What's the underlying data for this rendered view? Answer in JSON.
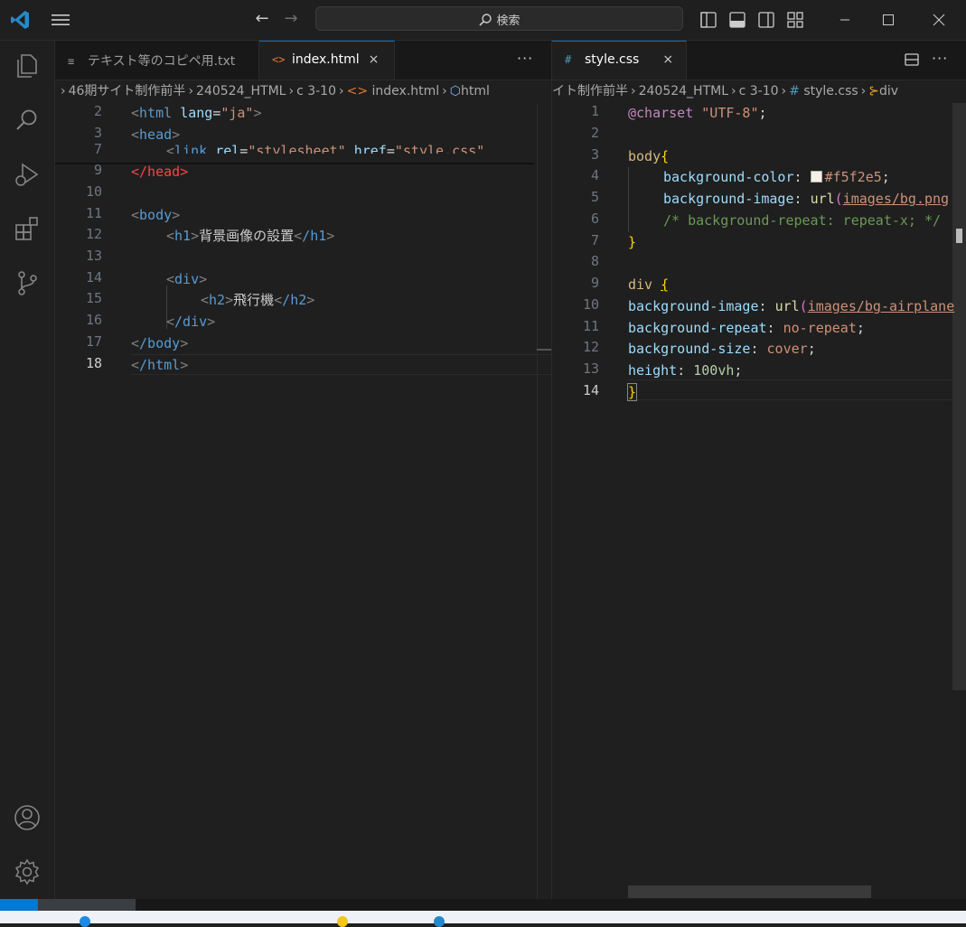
{
  "titlebar": {
    "search_label": "検索"
  },
  "left_group": {
    "tabs": [
      {
        "label": "テキスト等のコピペ用.txt",
        "icon": "≡",
        "active": false
      },
      {
        "label": "index.html",
        "icon": "<>",
        "active": true,
        "close": "×"
      }
    ],
    "tab_actions": "···",
    "breadcrumb": [
      {
        "label": "46期サイト制作前半"
      },
      {
        "label": "240524_HTML"
      },
      {
        "label": "c 3-10"
      },
      {
        "label": "index.html"
      },
      {
        "label": "html"
      }
    ],
    "lines": [
      {
        "n": "2"
      },
      {
        "n": "3"
      },
      {
        "n": "7"
      },
      {
        "n": "9"
      },
      {
        "n": "10"
      },
      {
        "n": "11"
      },
      {
        "n": "12"
      },
      {
        "n": "13"
      },
      {
        "n": "14"
      },
      {
        "n": "15"
      },
      {
        "n": "16"
      },
      {
        "n": "17"
      },
      {
        "n": "18"
      }
    ],
    "code": {
      "l2_tag": "html",
      "l2_attr": "lang",
      "l2_val": "\"ja\"",
      "l3_tag": "head",
      "l7_tag": "link",
      "l7_attr1": "rel",
      "l7_val1": "\"stylesheet\"",
      "l7_attr2": "href",
      "l7_val2_q": "\"",
      "l7_val2": "style.css",
      "l7_val2_q2": "\"",
      "l9_tag": "/head",
      "l11_tag": "body",
      "l12_tag": "h1",
      "l12_text": "背景画像の設置",
      "l12_close": "/h1",
      "l14_tag": "div",
      "l15_tag": "h2",
      "l15_text": "飛行機",
      "l15_close": "/h2",
      "l16_tag": "/div",
      "l17_tag": "/body",
      "l18_tag": "/html"
    }
  },
  "right_group": {
    "tabs": [
      {
        "label": "style.css",
        "icon": "#",
        "active": true,
        "close": "×"
      }
    ],
    "tab_actions": "···",
    "breadcrumb": [
      {
        "label": "イト制作前半"
      },
      {
        "label": "240524_HTML"
      },
      {
        "label": "c 3-10"
      },
      {
        "label": "style.css"
      },
      {
        "label": "div"
      }
    ],
    "lines": [
      {
        "n": "1"
      },
      {
        "n": "2"
      },
      {
        "n": "3"
      },
      {
        "n": "4"
      },
      {
        "n": "5"
      },
      {
        "n": "6"
      },
      {
        "n": "7"
      },
      {
        "n": "8"
      },
      {
        "n": "9"
      },
      {
        "n": "10"
      },
      {
        "n": "11"
      },
      {
        "n": "12"
      },
      {
        "n": "13"
      },
      {
        "n": "14"
      }
    ],
    "code": {
      "l1_at": "@charset",
      "l1_str": "\"UTF-8\"",
      "l1_semi": ";",
      "l3_sel": "body",
      "l3_brace": "{",
      "l4_prop": "background-color",
      "l4_val": "#f5f2e5",
      "l5_prop": "background-image",
      "l5_fn": "url",
      "l5_url": "images/bg.png",
      "l6_com": "/* background-repeat: repeat-x; */",
      "l7_brace": "}",
      "l9_sel": "div",
      "l9_brace": "{",
      "l10_prop": "background-image",
      "l10_fn": "url",
      "l10_url": "images/bg-airplane",
      "l11_prop": "background-repeat",
      "l11_val": "no-repeat",
      "l12_prop": "background-size",
      "l12_val": "cover",
      "l13_prop": "height",
      "l13_num": "100",
      "l13_unit": "vh",
      "l14_brace": "}"
    }
  },
  "colors": {
    "accent": "#0078d4",
    "editor_bg": "#1f1f1f",
    "swatch": "#f5f2e5"
  }
}
